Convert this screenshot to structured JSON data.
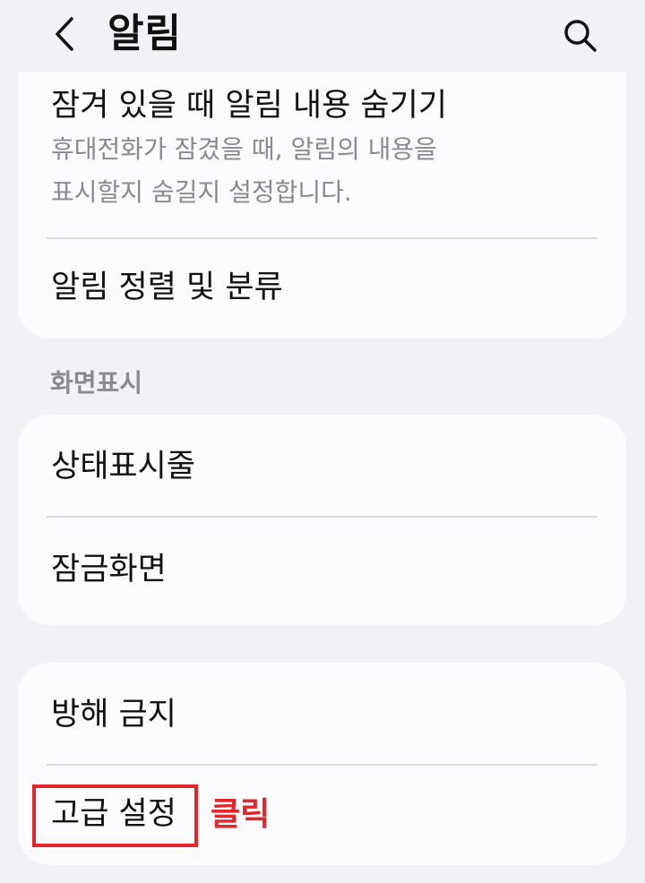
{
  "header": {
    "title": "알림",
    "back_icon": "chevron-left-icon",
    "search_icon": "search-icon"
  },
  "lock_card": {
    "hide_content": {
      "title": "잠겨 있을 때 알림 내용 숨기기",
      "description_line1": "휴대전화가 잠겼을 때, 알림의 내용을",
      "description_line2": "표시할지 숨길지 설정합니다."
    },
    "sort": {
      "title": "알림 정렬 및 분류"
    }
  },
  "display_section": {
    "header": "화면표시",
    "items": [
      {
        "title": "상태표시줄"
      },
      {
        "title": "잠금화면"
      }
    ]
  },
  "other_card": {
    "items": [
      {
        "title": "방해 금지"
      },
      {
        "title": "고급 설정"
      }
    ]
  },
  "annotation": {
    "label": "클릭",
    "color": "#e3262b"
  }
}
